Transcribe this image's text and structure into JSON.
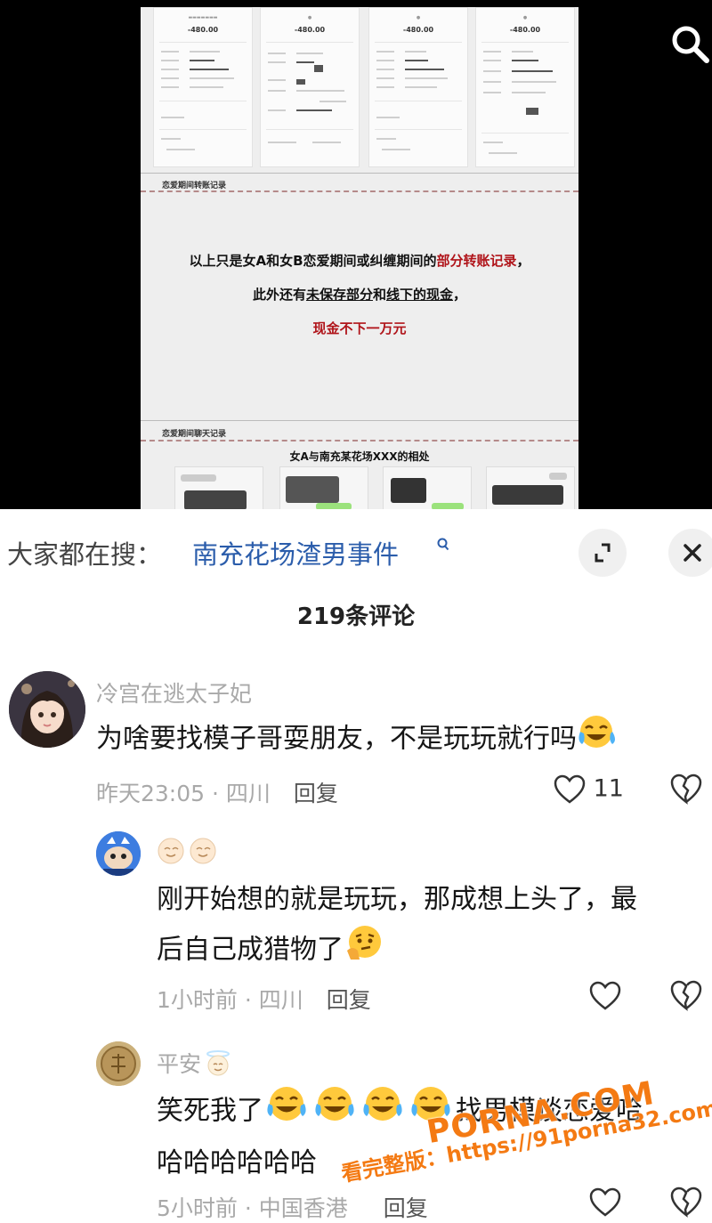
{
  "video": {
    "doc_section_transfer": "恋爱期间转账记录",
    "doc_line1_a": "以上只是女A和女B恋爱期间或纠缠期间的",
    "doc_line1_b": "部分转账记录",
    "doc_line1_c": "，",
    "doc_line2_a": "此外还有",
    "doc_line2_b": "未保存部分",
    "doc_line2_c": "和",
    "doc_line2_d": "线下的现金",
    "doc_line2_e": "，",
    "doc_line3": "现金不下一万元",
    "doc_section_chat": "恋爱期间聊天记录",
    "doc_chat_title": "女A与南充某花场XXX的相处",
    "receipt_amounts": [
      "-480.00",
      "-480.00",
      "-480.00",
      "-480.00"
    ]
  },
  "search": {
    "prefix": "大家都在搜：",
    "keyword": "南充花场渣男事件"
  },
  "comments_header": "219条评论",
  "comments": [
    {
      "username": "冷宫在逃太子妃",
      "text": "为啥要找模子哥耍朋友，不是玩玩就行吗",
      "time": "昨天23:05",
      "location": "四川",
      "reply": "回复",
      "likes": "11"
    },
    {
      "username": "",
      "text_line1": "刚开始想的就是玩玩，那成想上头了，最",
      "text_line2": "后自己成猎物了",
      "time": "1小时前",
      "location": "四川",
      "reply": "回复"
    },
    {
      "username": "平安",
      "text_line1a": "笑死我了",
      "text_line1b": "找男模谈恋爱哈",
      "text_line2": "哈哈哈哈哈哈",
      "time": "5小时前",
      "location": "中国香港",
      "reply": "回复"
    }
  ],
  "watermark": {
    "brand": "PORNA.COM",
    "url_line": "看完整版：https://91porna32.com"
  },
  "colors": {
    "keyword": "#2b5dab",
    "doc_red": "#b0141a",
    "watermark": "#f47a13"
  }
}
